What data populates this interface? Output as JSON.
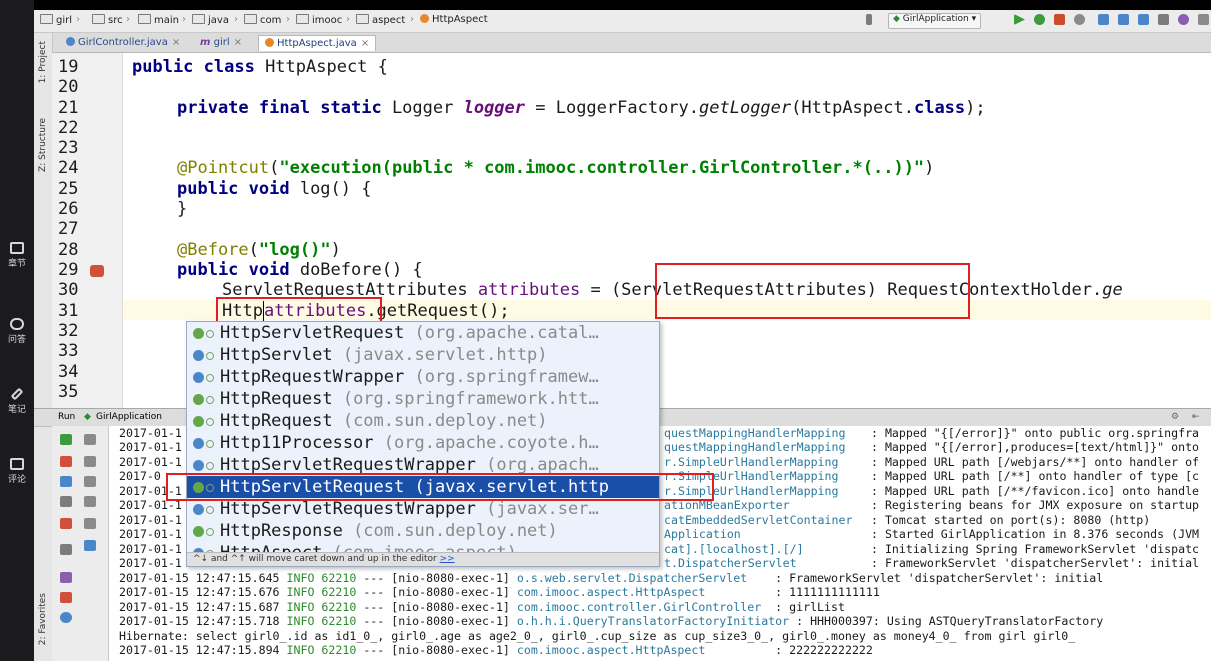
{
  "overlay_sidebar": {
    "items": [
      {
        "label": "章节"
      },
      {
        "label": "问答"
      },
      {
        "label": "笔记"
      },
      {
        "label": "评论"
      }
    ]
  },
  "breadcrumb": {
    "items": [
      "girl",
      "src",
      "main",
      "java",
      "com",
      "imooc",
      "aspect",
      "HttpAspect"
    ]
  },
  "run_config": "GirlApplication",
  "tabs": [
    {
      "label": "GirlController.java"
    },
    {
      "label": "girl"
    },
    {
      "label": "HttpAspect.java"
    }
  ],
  "tool_stripe": {
    "project": "1: Project",
    "structure": "Z: Structure",
    "favorites": "2: Favorites"
  },
  "editor": {
    "line_numbers": [
      "19",
      "20",
      "21",
      "22",
      "23",
      "24",
      "25",
      "26",
      "27",
      "28",
      "29",
      "30",
      "31",
      "32",
      "33",
      "34",
      "35"
    ],
    "lines": {
      "l19": {
        "kw": "public class",
        "rest": " HttpAspect {"
      },
      "l21": {
        "kw": "private final static",
        "type": " Logger ",
        "field": "logger",
        "eq": " = LoggerFactory.",
        "method": "getLogger",
        "args": "(HttpAspect.",
        "cls": "class",
        "end": ");"
      },
      "l24": {
        "ann": "@Pointcut",
        "open": "(",
        "str": "\"execution(public * com.imooc.controller.GirlController.*(..))\"",
        "close": ")"
      },
      "l25": {
        "kw": "public void",
        "rest": " log() {"
      },
      "l26": "}",
      "l28": {
        "ann": "@Before",
        "open": "(",
        "str": "\"log()\"",
        "close": ")"
      },
      "l29": {
        "kw": "public void",
        "rest": " doBefore() {"
      },
      "l30": {
        "text": "ServletRequestAttributes ",
        "var": "attributes",
        "rest": " = (ServletRequestAttributes) RequestContextHolder.",
        "method": "ge"
      },
      "l31": {
        "prefix": "Http",
        "word": "attributes",
        "rest": ".getRequest();"
      }
    }
  },
  "completion": {
    "items": [
      {
        "name": "HttpServletRequest",
        "pkg": " (org.apache.catal…"
      },
      {
        "name": "HttpServlet",
        "pkg": " (javax.servlet.http)"
      },
      {
        "name": "HttpRequestWrapper",
        "pkg": " (org.springframew…"
      },
      {
        "name": "HttpRequest",
        "pkg": " (org.springframework.htt…"
      },
      {
        "name": "HttpRequest",
        "pkg": " (com.sun.deploy.net)"
      },
      {
        "name": "Http11Processor",
        "pkg": " (org.apache.coyote.h…"
      },
      {
        "name": "HttpServletRequestWrapper",
        "pkg": " (org.apach…"
      },
      {
        "name": "HttpServletRequest",
        "pkg": " (javax.servlet.http"
      },
      {
        "name": "HttpServletRequestWrapper",
        "pkg": " (javax.ser…"
      },
      {
        "name": "HttpResponse",
        "pkg": " (com.sun.deploy.net)"
      },
      {
        "name": "HttpAspect",
        "pkg": " (com.imooc.aspect)"
      }
    ],
    "selected_index": 7,
    "footer": "^↓ and ^↑ will move caret down and up in the editor",
    "footer_link": ">>"
  },
  "run_panel": {
    "label": "Run",
    "config": "GirlApplication"
  },
  "console": {
    "lines": [
      {
        "left": "2017-01-1",
        "logger": "questMappingHandlerMapping",
        "msg": " : Mapped \"{[/error]}\" onto public org.springfra"
      },
      {
        "left": "2017-01-1",
        "logger": "questMappingHandlerMapping",
        "msg": " : Mapped \"{[/error],produces=[text/html]}\" onto"
      },
      {
        "left": "2017-01-1",
        "logger": "r.SimpleUrlHandlerMapping",
        "msg": " : Mapped URL path [/webjars/**] onto handler of"
      },
      {
        "left": "2017-0",
        "logger": "r.SimpleUrlHandlerMapping",
        "msg": " : Mapped URL path [/**] onto handler of type [c"
      },
      {
        "left": "2017-01-1",
        "logger": "r.SimpleUrlHandlerMapping",
        "msg": " : Mapped URL path [/**/favicon.ico] onto handle"
      },
      {
        "left": "2017-01-1",
        "logger": "ationMBeanExporter",
        "msg": " : Registering beans for JMX exposure on startup"
      },
      {
        "left": "2017-01-1",
        "logger": "catEmbeddedServletContainer",
        "msg": " : Tomcat started on port(s): 8080 (http)"
      },
      {
        "left": "2017-01-1",
        "logger": "Application",
        "msg": " : Started GirlApplication in 8.376 seconds (JVM"
      },
      {
        "left": "2017-01-1",
        "logger": "cat].[localhost].[/]",
        "msg": " : Initializing Spring FrameworkServlet 'dispatc"
      },
      {
        "left": "2017-01-1",
        "logger": "t.DispatcherServlet",
        "msg": " : FrameworkServlet 'dispatcherServlet': initial"
      },
      {
        "left": "2017-01-15 12:47:15.645 ",
        "info": "INFO 62210",
        "mid": " --- [nio-8080-exec-1] ",
        "logger": "o.s.web.servlet.DispatcherServlet",
        "msg": "    : FrameworkServlet 'dispatcherServlet': initial"
      },
      {
        "left": "2017-01-15 12:47:15.676 ",
        "info": "INFO 62210",
        "mid": " --- [nio-8080-exec-1] ",
        "logger": "com.imooc.aspect.HttpAspect",
        "msg": "          : 1111111111111"
      },
      {
        "left": "2017-01-15 12:47:15.687 ",
        "info": "INFO 62210",
        "mid": " --- [nio-8080-exec-1] ",
        "logger": "com.imooc.controller.GirlController",
        "msg": "  : girlList"
      },
      {
        "left": "2017-01-15 12:47:15.718 ",
        "info": "INFO 62210",
        "mid": " --- [nio-8080-exec-1] ",
        "logger": "o.h.h.i.QueryTranslatorFactoryInitiator",
        "msg": " : HHH000397: Using ASTQueryTranslatorFactory"
      },
      {
        "plain": "Hibernate: select girl0_.id as id1_0_, girl0_.age as age2_0_, girl0_.cup_size as cup_size3_0_, girl0_.money as money4_0_ from girl girl0_"
      },
      {
        "left": "2017-01-15 12:47:15.894 ",
        "info": "INFO 62210",
        "mid": " --- [nio-8080-exec-1] ",
        "logger": "com.imooc.aspect.HttpAspect",
        "msg": "          : 222222222222"
      }
    ]
  },
  "colors": {
    "keyword": "#000080",
    "annotation": "#808000",
    "string": "#008000",
    "selection": "#1a4fa8",
    "highlight_box": "#e02020"
  }
}
